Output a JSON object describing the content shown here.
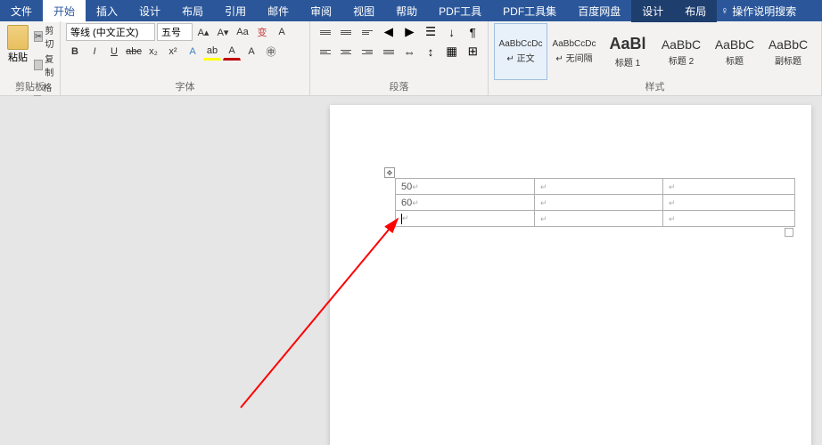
{
  "tabs": {
    "file": "文件",
    "home": "开始",
    "insert": "插入",
    "design": "设计",
    "layout": "布局",
    "references": "引用",
    "mail": "邮件",
    "review": "审阅",
    "view": "视图",
    "help": "帮助",
    "pdftool": "PDF工具",
    "pdfset": "PDF工具集",
    "baidu": "百度网盘",
    "design2": "设计",
    "layout2": "布局",
    "tellme": "操作说明搜索"
  },
  "clipboard": {
    "paste": "粘贴",
    "cut": "剪切",
    "copy": "复制",
    "format": "格式刷",
    "label": "剪贴板"
  },
  "font": {
    "name": "等线 (中文正文)",
    "size": "五号",
    "label": "字体"
  },
  "paragraph": {
    "label": "段落"
  },
  "styles": {
    "label": "样式",
    "items": [
      {
        "preview": "AaBbCcDc",
        "name": "↵ 正文",
        "cls": ""
      },
      {
        "preview": "AaBbCcDc",
        "name": "↵ 无间隔",
        "cls": ""
      },
      {
        "preview": "AaBl",
        "name": "标题 1",
        "cls": "big"
      },
      {
        "preview": "AaBbC",
        "name": "标题 2",
        "cls": "med"
      },
      {
        "preview": "AaBbC",
        "name": "标题",
        "cls": "med"
      },
      {
        "preview": "AaBbC",
        "name": "副标题",
        "cls": "med"
      }
    ]
  },
  "table": {
    "rows": [
      [
        "50",
        "",
        ""
      ],
      [
        "60",
        "",
        ""
      ],
      [
        "",
        "",
        ""
      ]
    ]
  }
}
